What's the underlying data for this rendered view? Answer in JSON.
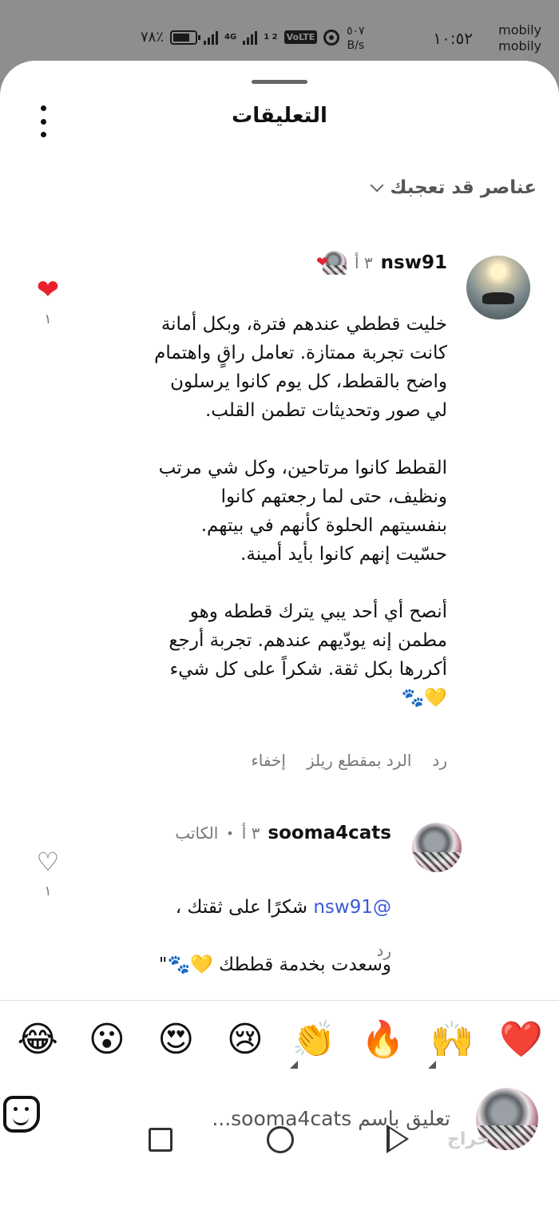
{
  "status_bar": {
    "carrier_line1": "mobily",
    "carrier_line2": "mobily",
    "time": "١٠:٥٢",
    "speed_value": "٥٠٧",
    "speed_unit": "B/s",
    "network_4g": "4G",
    "sim_label": "1 2",
    "volte": "VoLTE",
    "battery_percent": "٧٨٪"
  },
  "sheet": {
    "title": "التعليقات",
    "filter_label": "عناصر قد تعجبك"
  },
  "comments": [
    {
      "username": "nsw91",
      "time": "٣ أ",
      "body": "خليت قططي عندهم فترة، وبكل أمانة\nكانت تجربة ممتازة. تعامل راقٍ واهتمام\nواضح بالقطط، كل يوم كانوا يرسلون\nلي صور وتحديثات تطمن القلب.\n\nالقطط كانوا مرتاحين، وكل شي مرتب\nونظيف، حتى لما رجعتهم كانوا\nبنفسيتهم الحلوة كأنهم في بيتهم.\nحسّيت إنهم كانوا بأيد أمينة.\n\nأنصح أي أحد يبي يترك قططه وهو\nمطمن إنه يودّيهم عندهم. تجربة أرجع\nأكررها بكل ثقة. شكراً على كل شيء\n💛🐾",
      "like_count": "١",
      "actions": {
        "reply": "رد",
        "reply_reel": "الرد بمقطع ريلز",
        "hide": "إخفاء"
      }
    },
    {
      "username": "sooma4cats",
      "time": "٣ أ",
      "author_badge": "الكاتب",
      "mention": "@nsw91",
      "body_line1": " شكرًا على ثقتك ،",
      "body_line2": "وسعدت بخدمة قططك 💛🐾\"",
      "like_count": "١",
      "reply": "رد"
    }
  ],
  "reactions": [
    "❤️",
    "🙌",
    "🔥",
    "👏",
    "😢",
    "😍",
    "😮",
    "😂"
  ],
  "composer": {
    "placeholder": "تعليق باسم sooma4cats..."
  },
  "watermark": "حراج",
  "colors": {
    "accent_mention": "#3a5ad9",
    "like_red": "#e8202b",
    "status_bar_bg": "#8e8e8e"
  },
  "icons": {
    "more": "more-vertical-icon",
    "filter_chevron": "chevron-down-icon",
    "sticker": "sticker-icon",
    "nav_recents": "square-icon",
    "nav_home": "circle-icon",
    "nav_back": "triangle-back-icon"
  }
}
